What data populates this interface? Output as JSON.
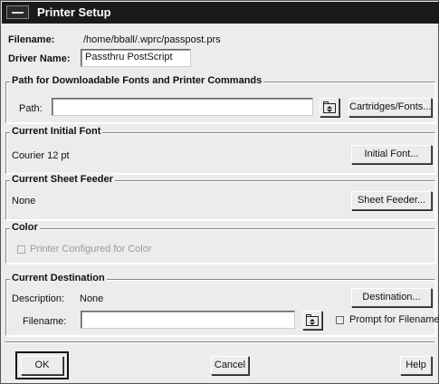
{
  "window": {
    "title": "Printer Setup"
  },
  "filename_row": {
    "label": "Filename:",
    "value": "/home/bball/.wprc/passpost.prs"
  },
  "driver_row": {
    "label": "Driver Name:",
    "value": "Passthru PostScript"
  },
  "fonts_group": {
    "title": "Path for Downloadable Fonts and Printer Commands",
    "path_label": "Path:",
    "path_value": "",
    "cartridges_button": "Cartridges/Fonts..."
  },
  "initial_font_group": {
    "title": "Current Initial Font",
    "value": "Courier 12 pt",
    "button": "Initial Font..."
  },
  "sheet_feeder_group": {
    "title": "Current Sheet Feeder",
    "value": "None",
    "button": "Sheet Feeder..."
  },
  "color_group": {
    "title": "Color",
    "checkbox_label": "Printer Configured for Color",
    "checked": false,
    "enabled": false
  },
  "destination_group": {
    "title": "Current Destination",
    "description_label": "Description:",
    "description_value": "None",
    "destination_button": "Destination...",
    "filename_label": "Filename:",
    "filename_value": "",
    "prompt_label": "Prompt for Filename",
    "prompt_checked": false
  },
  "footer": {
    "ok": "OK",
    "cancel": "Cancel",
    "help": "Help"
  },
  "icons": {
    "system_menu": "system-menu-icon",
    "folder_browse": "folder-browse-icon"
  }
}
